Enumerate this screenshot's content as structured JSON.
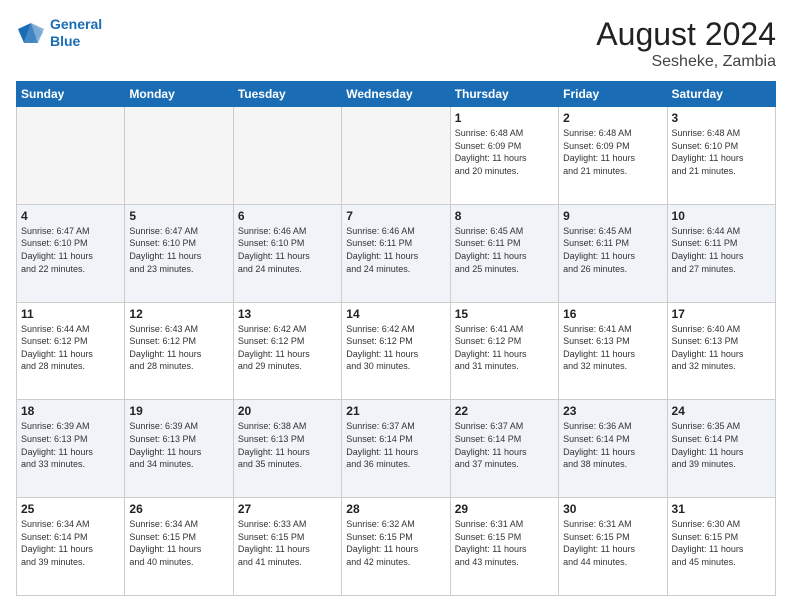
{
  "logo": {
    "line1": "General",
    "line2": "Blue"
  },
  "title": {
    "month_year": "August 2024",
    "location": "Sesheke, Zambia"
  },
  "days_of_week": [
    "Sunday",
    "Monday",
    "Tuesday",
    "Wednesday",
    "Thursday",
    "Friday",
    "Saturday"
  ],
  "weeks": [
    [
      {
        "num": "",
        "detail": ""
      },
      {
        "num": "",
        "detail": ""
      },
      {
        "num": "",
        "detail": ""
      },
      {
        "num": "",
        "detail": ""
      },
      {
        "num": "1",
        "detail": "Sunrise: 6:48 AM\nSunset: 6:09 PM\nDaylight: 11 hours\nand 20 minutes."
      },
      {
        "num": "2",
        "detail": "Sunrise: 6:48 AM\nSunset: 6:09 PM\nDaylight: 11 hours\nand 21 minutes."
      },
      {
        "num": "3",
        "detail": "Sunrise: 6:48 AM\nSunset: 6:10 PM\nDaylight: 11 hours\nand 21 minutes."
      }
    ],
    [
      {
        "num": "4",
        "detail": "Sunrise: 6:47 AM\nSunset: 6:10 PM\nDaylight: 11 hours\nand 22 minutes."
      },
      {
        "num": "5",
        "detail": "Sunrise: 6:47 AM\nSunset: 6:10 PM\nDaylight: 11 hours\nand 23 minutes."
      },
      {
        "num": "6",
        "detail": "Sunrise: 6:46 AM\nSunset: 6:10 PM\nDaylight: 11 hours\nand 24 minutes."
      },
      {
        "num": "7",
        "detail": "Sunrise: 6:46 AM\nSunset: 6:11 PM\nDaylight: 11 hours\nand 24 minutes."
      },
      {
        "num": "8",
        "detail": "Sunrise: 6:45 AM\nSunset: 6:11 PM\nDaylight: 11 hours\nand 25 minutes."
      },
      {
        "num": "9",
        "detail": "Sunrise: 6:45 AM\nSunset: 6:11 PM\nDaylight: 11 hours\nand 26 minutes."
      },
      {
        "num": "10",
        "detail": "Sunrise: 6:44 AM\nSunset: 6:11 PM\nDaylight: 11 hours\nand 27 minutes."
      }
    ],
    [
      {
        "num": "11",
        "detail": "Sunrise: 6:44 AM\nSunset: 6:12 PM\nDaylight: 11 hours\nand 28 minutes."
      },
      {
        "num": "12",
        "detail": "Sunrise: 6:43 AM\nSunset: 6:12 PM\nDaylight: 11 hours\nand 28 minutes."
      },
      {
        "num": "13",
        "detail": "Sunrise: 6:42 AM\nSunset: 6:12 PM\nDaylight: 11 hours\nand 29 minutes."
      },
      {
        "num": "14",
        "detail": "Sunrise: 6:42 AM\nSunset: 6:12 PM\nDaylight: 11 hours\nand 30 minutes."
      },
      {
        "num": "15",
        "detail": "Sunrise: 6:41 AM\nSunset: 6:12 PM\nDaylight: 11 hours\nand 31 minutes."
      },
      {
        "num": "16",
        "detail": "Sunrise: 6:41 AM\nSunset: 6:13 PM\nDaylight: 11 hours\nand 32 minutes."
      },
      {
        "num": "17",
        "detail": "Sunrise: 6:40 AM\nSunset: 6:13 PM\nDaylight: 11 hours\nand 32 minutes."
      }
    ],
    [
      {
        "num": "18",
        "detail": "Sunrise: 6:39 AM\nSunset: 6:13 PM\nDaylight: 11 hours\nand 33 minutes."
      },
      {
        "num": "19",
        "detail": "Sunrise: 6:39 AM\nSunset: 6:13 PM\nDaylight: 11 hours\nand 34 minutes."
      },
      {
        "num": "20",
        "detail": "Sunrise: 6:38 AM\nSunset: 6:13 PM\nDaylight: 11 hours\nand 35 minutes."
      },
      {
        "num": "21",
        "detail": "Sunrise: 6:37 AM\nSunset: 6:14 PM\nDaylight: 11 hours\nand 36 minutes."
      },
      {
        "num": "22",
        "detail": "Sunrise: 6:37 AM\nSunset: 6:14 PM\nDaylight: 11 hours\nand 37 minutes."
      },
      {
        "num": "23",
        "detail": "Sunrise: 6:36 AM\nSunset: 6:14 PM\nDaylight: 11 hours\nand 38 minutes."
      },
      {
        "num": "24",
        "detail": "Sunrise: 6:35 AM\nSunset: 6:14 PM\nDaylight: 11 hours\nand 39 minutes."
      }
    ],
    [
      {
        "num": "25",
        "detail": "Sunrise: 6:34 AM\nSunset: 6:14 PM\nDaylight: 11 hours\nand 39 minutes."
      },
      {
        "num": "26",
        "detail": "Sunrise: 6:34 AM\nSunset: 6:15 PM\nDaylight: 11 hours\nand 40 minutes."
      },
      {
        "num": "27",
        "detail": "Sunrise: 6:33 AM\nSunset: 6:15 PM\nDaylight: 11 hours\nand 41 minutes."
      },
      {
        "num": "28",
        "detail": "Sunrise: 6:32 AM\nSunset: 6:15 PM\nDaylight: 11 hours\nand 42 minutes."
      },
      {
        "num": "29",
        "detail": "Sunrise: 6:31 AM\nSunset: 6:15 PM\nDaylight: 11 hours\nand 43 minutes."
      },
      {
        "num": "30",
        "detail": "Sunrise: 6:31 AM\nSunset: 6:15 PM\nDaylight: 11 hours\nand 44 minutes."
      },
      {
        "num": "31",
        "detail": "Sunrise: 6:30 AM\nSunset: 6:15 PM\nDaylight: 11 hours\nand 45 minutes."
      }
    ]
  ]
}
